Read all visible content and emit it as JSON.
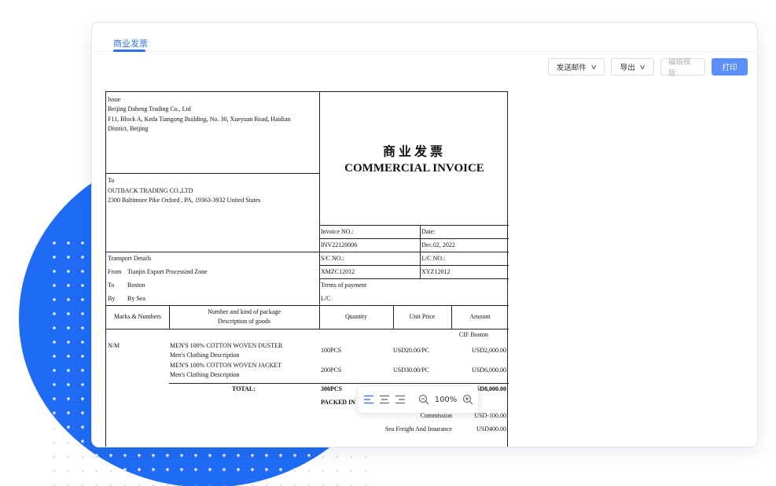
{
  "tabs": [
    {
      "label": "商业发票",
      "active": true
    }
  ],
  "toolbar": {
    "send_label": "发送邮件",
    "export_label": "导出",
    "edit_template_label": "编辑模版",
    "print_label": "打印"
  },
  "invoice": {
    "issue_label": "Issue",
    "issuer_name": "Beijing Daheng Trading Co., Ltd",
    "issuer_address_1": "F11, Block A, Keda Tiangong Building, No. 30, Xueyuan Road, Haidian",
    "issuer_address_2": "District, Beijing",
    "to_label": "To",
    "consignee_name": "OUTBACK TRADING CO.,LTD",
    "consignee_address": "2300 Baltimore Pike Oxford , PA, 19363-3932 United States",
    "title_cn": "商业发票",
    "title_en": "COMMERCIAL INVOICE",
    "invoice_no_label": "Invoice NO.:",
    "invoice_no": "INV22120006",
    "date_label": "Date:",
    "date": "Dec.02, 2022",
    "sc_no_label": "S/C NO.:",
    "sc_no": "XMZC12012",
    "lc_no_label": "L/C NO.:",
    "lc_no": "XYZ12012",
    "transport_label": "Transport Details",
    "from_label": "From",
    "from": "Tianjin Export Processind Zone",
    "to_port_label": "To",
    "to_port": "Boston",
    "by_label": "By",
    "by": "By Sea",
    "terms_label": "Terms of payment",
    "terms": "L/C",
    "columns": {
      "marks": "Marks & Numbers",
      "package_1": "Number and kind of package",
      "package_2": "Description of goods",
      "quantity": "Quantity",
      "unit_price": "Unit Price",
      "amount": "Amount"
    },
    "price_term": "CIF Boston",
    "marks_value": "N/M",
    "items": [
      {
        "name": "MEN'S 100% COTTON WOVEN DUSTER",
        "desc": "Men's Clothing Description",
        "qty": "100PCS",
        "price": "USD20.00/PC",
        "amount": "USD2,000.00"
      },
      {
        "name": "MEN'S 100% COTTON WOVEN JACKET",
        "desc": "Men's Clothing Description",
        "qty": "200PCS",
        "price": "USD30.00/PC",
        "amount": "USD6,000.00"
      }
    ],
    "total_label": "TOTAL:",
    "total_qty": "300PCS",
    "total_amount": "USD8,000.00",
    "packed_label": "PACKED IN",
    "commission_label": "Commission",
    "commission": "USD-100.00",
    "freight_label": "Sea Freight And Insurance",
    "freight": "USD400.00"
  },
  "zoom": {
    "level": "100%"
  }
}
